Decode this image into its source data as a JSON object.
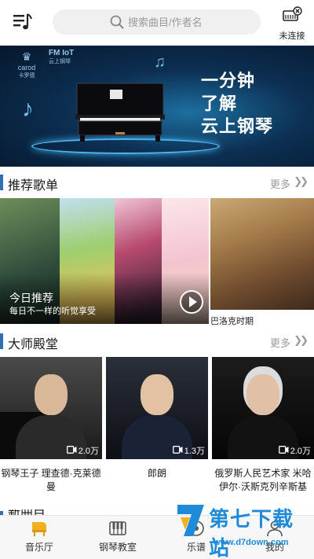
{
  "header": {
    "menu_icon": "music-list-icon",
    "search": {
      "placeholder": "搜索曲目/作者名",
      "icon": "search-icon"
    },
    "connection": {
      "label": "未连接",
      "icon": "piano-disconnected-icon"
    }
  },
  "banner": {
    "brand_left": "carod",
    "brand_left_sub": "卡罗德",
    "brand_right": "FM IoT",
    "brand_right_sub": "云上钢琴",
    "slogan": [
      "一分钟",
      "了解",
      "云上钢琴"
    ]
  },
  "recommend": {
    "title": "推荐歌单",
    "more": "更多",
    "main": {
      "title": "今日推荐",
      "subtitle": "每日不一样的听觉享受"
    },
    "side": {
      "caption": "巴洛克时期"
    }
  },
  "masters": {
    "title": "大师殿堂",
    "more": "更多",
    "items": [
      {
        "name": "钢琴王子 理查德·克莱德曼",
        "views": "2.0万"
      },
      {
        "name": "郎朗",
        "views": "1.3万"
      },
      {
        "name": "俄罗斯人民艺术家 米哈伊尔·沃斯克列辛斯基",
        "views": "2.0万"
      }
    ]
  },
  "partial_section": {
    "title": "新曲目"
  },
  "bottom_nav": {
    "items": [
      {
        "label": "音乐厅",
        "icon": "grand-piano-icon",
        "active": true
      },
      {
        "label": "钢琴教室",
        "icon": "keyboard-icon",
        "active": false
      },
      {
        "label": "乐谱",
        "icon": "score-icon",
        "active": false
      },
      {
        "label": "我的",
        "icon": "user-icon",
        "active": false
      }
    ]
  },
  "watermark": {
    "text": "第七下载站",
    "url": "www.d7down.com"
  },
  "colors": {
    "accent": "#2f6fb6",
    "nav_active": "#f0b020",
    "watermark": "#1f8bd8"
  }
}
